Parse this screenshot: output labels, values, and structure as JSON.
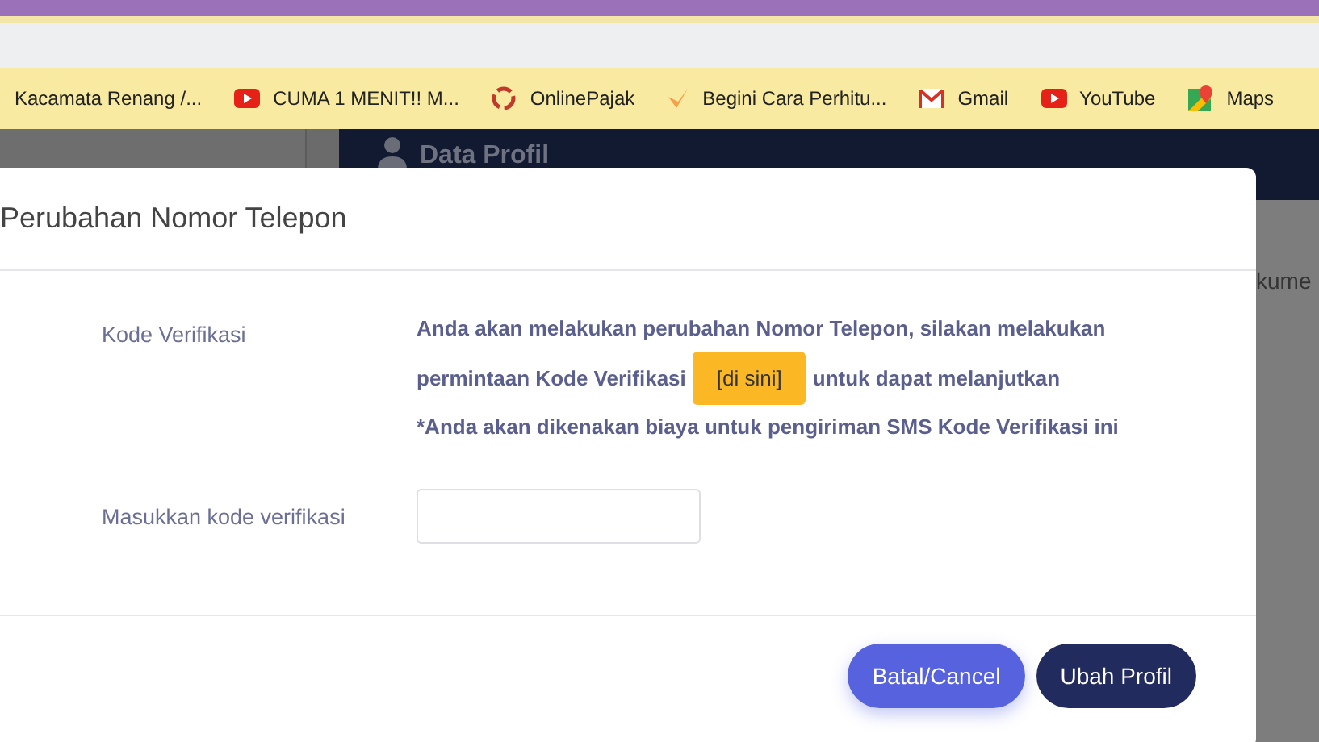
{
  "bookmarks": [
    {
      "label": "Kacamata Renang /..."
    },
    {
      "label": "CUMA 1 MENIT!! M..."
    },
    {
      "label": "OnlinePajak"
    },
    {
      "label": "Begini Cara Perhitu..."
    },
    {
      "label": "Gmail"
    },
    {
      "label": "YouTube"
    },
    {
      "label": "Maps"
    }
  ],
  "page": {
    "header": "Data Profil",
    "side_text": "kume"
  },
  "modal": {
    "title": "Perubahan Nomor Telepon",
    "rows": [
      {
        "kind": "message",
        "label": "Kode Verifikasi",
        "line_1": "Anda akan melakukan perubahan Nomor Telepon, silakan melakukan",
        "line_2_start": "permintaan Kode Verifikasi",
        "link_button": "[di sini]",
        "line_2_end": "untuk dapat melanjutkan",
        "note": "*Anda akan dikenakan biaya untuk pengiriman SMS Kode Verifikasi ini"
      },
      {
        "kind": "input",
        "label": "Masukkan kode verifikasi"
      }
    ],
    "buttons": [
      {
        "label": "Batal/Cancel",
        "kind": "secondary"
      },
      {
        "label": "Ubah Profil",
        "kind": "primary"
      }
    ]
  }
}
